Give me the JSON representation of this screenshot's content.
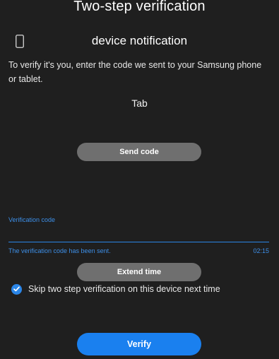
{
  "header": {
    "title": "Two-step verification"
  },
  "method": {
    "icon": "phone-icon",
    "label": "device notification"
  },
  "instructions": "To verify it's you, enter the code we sent to your Samsung phone or tablet.",
  "device": {
    "name": "Tab"
  },
  "buttons": {
    "send_code": "Send code",
    "extend_time": "Extend time",
    "verify": "Verify"
  },
  "code_field": {
    "label": "Verification code",
    "value": "",
    "status": "The verification code has been sent.",
    "timer": "02:15"
  },
  "skip_option": {
    "label": "Skip two step verification on this device next time",
    "checked": true
  },
  "colors": {
    "background": "#1f1f1f",
    "accent": "#1a80ef",
    "button_gray": "#6f6f6f"
  }
}
